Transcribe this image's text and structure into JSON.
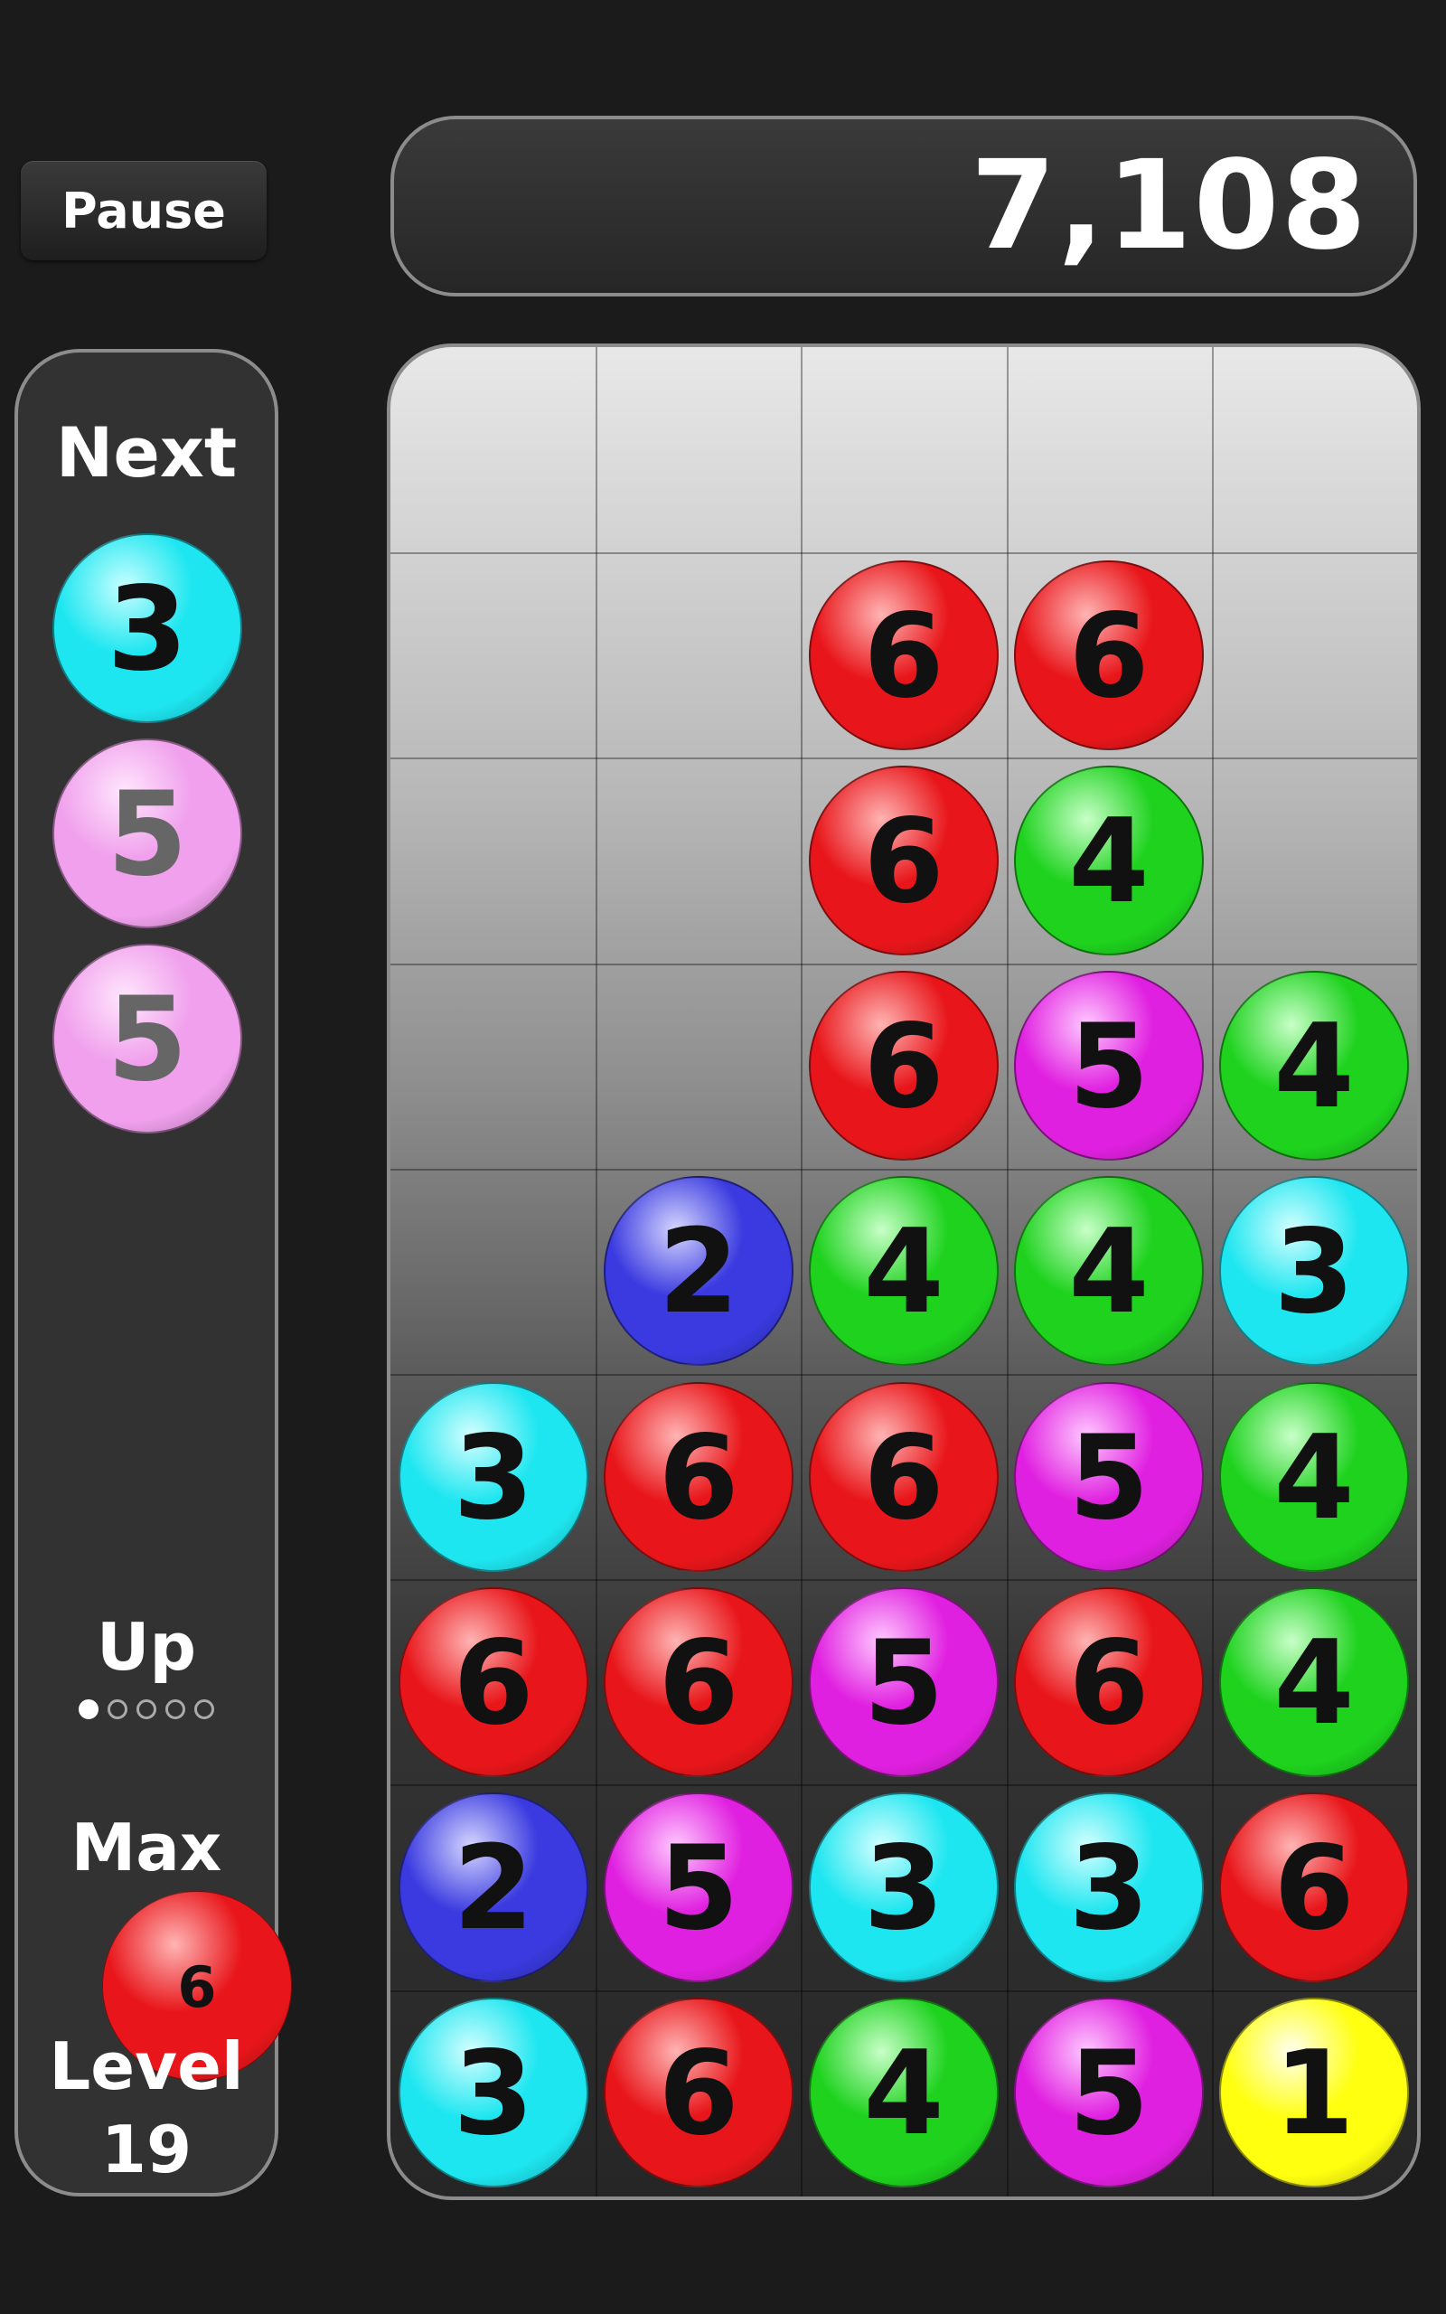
{
  "pause_label": "Pause",
  "score": "7,108",
  "next": {
    "label": "Next",
    "balls": [
      {
        "value": "3",
        "color": "#1ee6f0",
        "highlight": "#c8ffff",
        "pale": false
      },
      {
        "value": "5",
        "color": "#f0a0ec",
        "highlight": "#ffe6fd",
        "pale": true
      },
      {
        "value": "5",
        "color": "#f0a0ec",
        "highlight": "#ffe6fd",
        "pale": true
      }
    ]
  },
  "up": {
    "label": "Up",
    "filled": 1,
    "total": 5
  },
  "max": {
    "label": "Max",
    "value": "6",
    "color": "#e8161a",
    "highlight": "#ffb4b4"
  },
  "level": {
    "label": "Level",
    "value": "19"
  },
  "ball_colors": {
    "1": {
      "color": "#ffff10",
      "highlight": "#fffff0"
    },
    "2": {
      "color": "#3a3ae0",
      "highlight": "#d6d6ff"
    },
    "3": {
      "color": "#1ee6f0",
      "highlight": "#d4ffff"
    },
    "4": {
      "color": "#1ed21e",
      "highlight": "#c8ffc8"
    },
    "5": {
      "color": "#e020e0",
      "highlight": "#ffc8ff"
    },
    "6": {
      "color": "#e8161a",
      "highlight": "#ffb4b4"
    }
  },
  "board": {
    "columns": 5,
    "rows": 9,
    "grid": [
      [
        "",
        "",
        "",
        "",
        ""
      ],
      [
        "",
        "",
        "6",
        "6",
        ""
      ],
      [
        "",
        "",
        "6",
        "4",
        ""
      ],
      [
        "",
        "",
        "6",
        "5",
        "4"
      ],
      [
        "",
        "2",
        "4",
        "4",
        "3"
      ],
      [
        "3",
        "6",
        "6",
        "5",
        "4"
      ],
      [
        "6",
        "6",
        "5",
        "6",
        "4"
      ],
      [
        "2",
        "5",
        "3",
        "3",
        "6"
      ],
      [
        "3",
        "6",
        "4",
        "5",
        "1"
      ]
    ]
  }
}
